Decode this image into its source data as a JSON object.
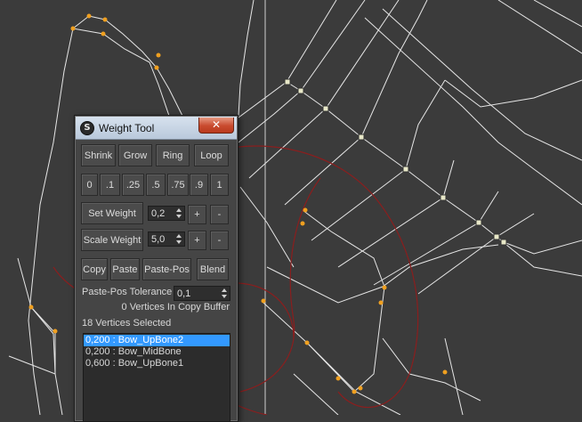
{
  "window": {
    "title": "Weight Tool",
    "app_icon_glyph": "S",
    "close_glyph": "✕"
  },
  "row_buttons": [
    {
      "label": "Shrink"
    },
    {
      "label": "Grow"
    },
    {
      "label": "Ring"
    },
    {
      "label": "Loop"
    }
  ],
  "preset_buttons": [
    {
      "label": "0"
    },
    {
      "label": ".1"
    },
    {
      "label": ".25"
    },
    {
      "label": ".5"
    },
    {
      "label": ".75"
    },
    {
      "label": ".9"
    },
    {
      "label": "1"
    }
  ],
  "set_weight": {
    "label": "Set Weight",
    "value": "0,2",
    "plus": "+",
    "minus": "-"
  },
  "scale_weight": {
    "label": "Scale Weight",
    "value": "5,0",
    "plus": "+",
    "minus": "-"
  },
  "clipboard_buttons": [
    {
      "label": "Copy"
    },
    {
      "label": "Paste"
    },
    {
      "label": "Paste-Pos"
    },
    {
      "label": "Blend"
    }
  ],
  "paste_pos_tolerance": {
    "label": "Paste-Pos Tolerance",
    "value": "0,1"
  },
  "copy_buffer_status": "0 Vertices In Copy Buffer",
  "selection_status": "18 Vertices Selected",
  "bone_list": [
    {
      "text": "0,200 : Bow_UpBone2",
      "selected": true
    },
    {
      "text": "0,200 : Bow_MidBone",
      "selected": false
    },
    {
      "text": "0,600 : Bow_UpBone1",
      "selected": false
    }
  ],
  "colors": {
    "viewport_bg": "#3b3b3b",
    "wire": "#e6e6e6",
    "envelope": "#8a1e1e",
    "vertex_selected": "#f0a020",
    "vertex_unselected": "#e8e8c8",
    "selection_highlight": "#3399ff"
  }
}
